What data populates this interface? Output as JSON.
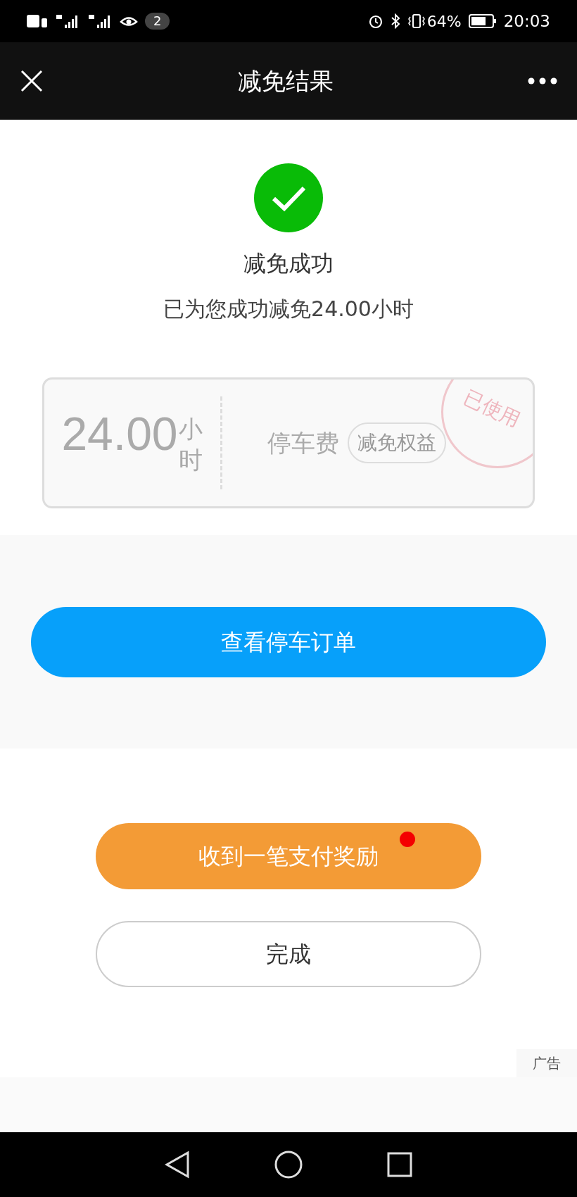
{
  "status_bar": {
    "notification_count": "2",
    "battery": "64%",
    "time": "20:03"
  },
  "nav_bar": {
    "title": "减免结果"
  },
  "result": {
    "title": "减免成功",
    "message": "已为您成功减免24.00小时"
  },
  "ticket": {
    "amount": "24.00",
    "unit": "小时",
    "name": "停车费",
    "tag": "减免权益",
    "stamp": "已使用"
  },
  "view_order_button": "查看停车订单",
  "reward_button": {
    "label": "收到一笔支付奖励",
    "unread": true
  },
  "done_button": "完成",
  "ad_label": "广告"
}
